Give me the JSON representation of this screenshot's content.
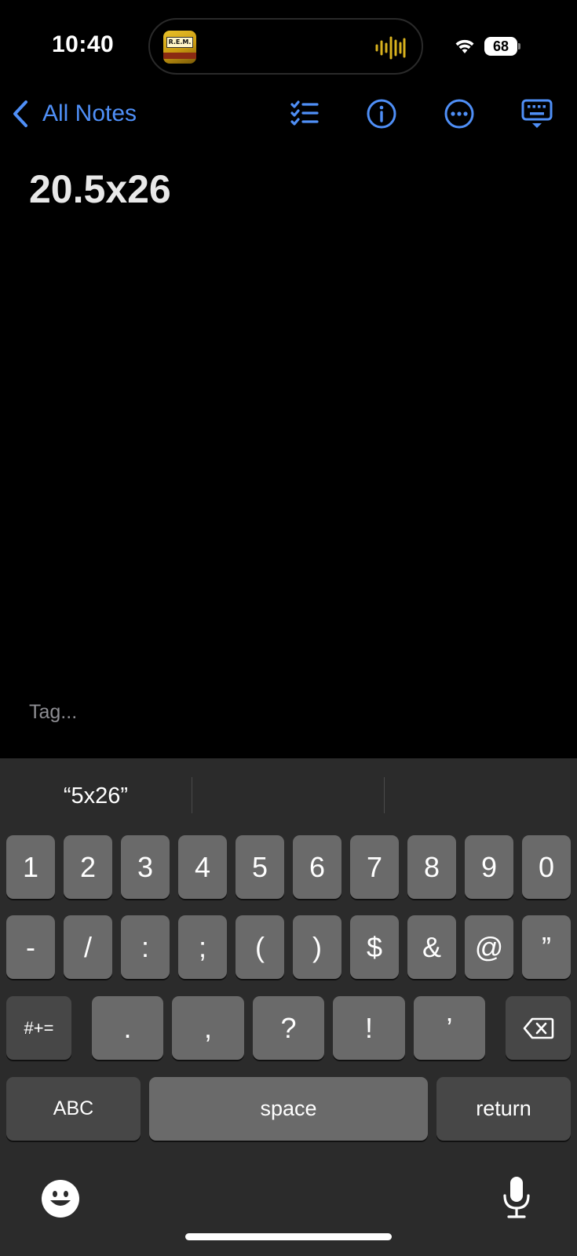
{
  "status_bar": {
    "time": "10:40",
    "now_playing_art_text": "R.E.M.",
    "battery": "68",
    "waveform_color": "#d9b21e"
  },
  "nav": {
    "back_label": "All Notes",
    "accent_color": "#4f8ff7",
    "icons": [
      "checklist-icon",
      "info-icon",
      "more-icon",
      "keyboard-dismiss-icon"
    ]
  },
  "note": {
    "title": "20.5x26",
    "tag_placeholder": "Tag..."
  },
  "keyboard": {
    "suggestions": [
      "“5x26”",
      "",
      ""
    ],
    "row1": [
      "1",
      "2",
      "3",
      "4",
      "5",
      "6",
      "7",
      "8",
      "9",
      "0"
    ],
    "row2": [
      "-",
      "/",
      ":",
      ";",
      "(",
      ")",
      "$",
      "&",
      "@",
      "”"
    ],
    "row3": {
      "toggle": "#+=",
      "keys": [
        ".",
        ",",
        "?",
        "!",
        "’"
      ],
      "delete_icon": "backspace-icon"
    },
    "row4": {
      "abc": "ABC",
      "space": "space",
      "return": "return"
    },
    "bottom_icons": [
      "emoji-icon",
      "microphone-icon"
    ]
  }
}
